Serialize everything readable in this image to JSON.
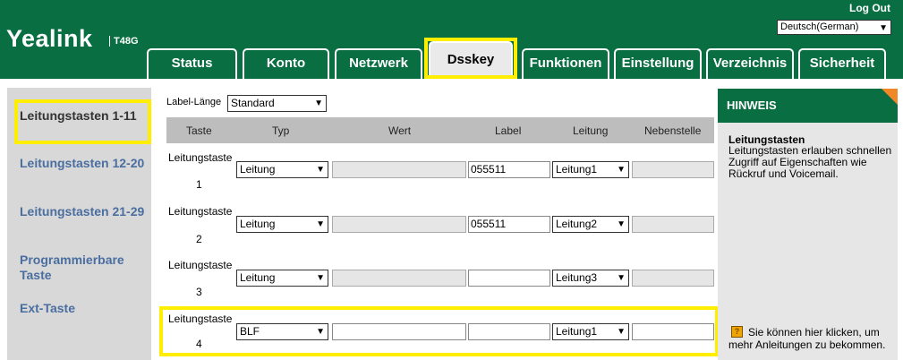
{
  "header": {
    "brand": "Yealink",
    "model": "T48G",
    "logout": "Log Out",
    "language": "Deutsch(German)"
  },
  "tabs": [
    {
      "label": "Status"
    },
    {
      "label": "Konto"
    },
    {
      "label": "Netzwerk"
    },
    {
      "label": "Dsskey"
    },
    {
      "label": "Funktionen"
    },
    {
      "label": "Einstellung"
    },
    {
      "label": "Verzeichnis"
    },
    {
      "label": "Sicherheit"
    }
  ],
  "sidebar": {
    "items": [
      {
        "label": "Leitungstasten 1-11"
      },
      {
        "label": "Leitungstasten 12-20"
      },
      {
        "label": "Leitungstasten 21-29"
      },
      {
        "label": "Programmierbare Taste"
      },
      {
        "label": "Ext-Taste"
      }
    ]
  },
  "main": {
    "label_length_label": "Label-Länge",
    "label_length_value": "Standard",
    "columns": [
      "Taste",
      "Typ",
      "Wert",
      "Label",
      "Leitung",
      "Nebenstelle"
    ],
    "rows": [
      {
        "taste": "Leitungstaste",
        "num": "1",
        "typ": "Leitung",
        "wert": "",
        "label": "055511",
        "leitung": "Leitung1",
        "nebenstelle": ""
      },
      {
        "taste": "Leitungstaste",
        "num": "2",
        "typ": "Leitung",
        "wert": "",
        "label": "055511",
        "leitung": "Leitung2",
        "nebenstelle": ""
      },
      {
        "taste": "Leitungstaste",
        "num": "3",
        "typ": "Leitung",
        "wert": "",
        "label": "",
        "leitung": "Leitung3",
        "nebenstelle": ""
      },
      {
        "taste": "Leitungstaste",
        "num": "4",
        "typ": "BLF",
        "wert": "",
        "label": "",
        "leitung": "Leitung1",
        "nebenstelle": ""
      }
    ]
  },
  "hint": {
    "heading": "HINWEIS",
    "title": "Leitungstasten",
    "text": "Leitungstasten erlauben schnellen Zugriff auf Eigenschaften wie Rückruf und Voicemail.",
    "more": "Sie können hier klicken, um mehr Anleitungen zu bekommen."
  },
  "colors": {
    "brand_green": "#0a6e43",
    "highlight_yellow": "#ffee00",
    "accent_orange": "#f0882a",
    "sidebar_link": "#4a6ea0"
  },
  "icons": [
    "book-icon",
    "chevron-down-icon"
  ]
}
